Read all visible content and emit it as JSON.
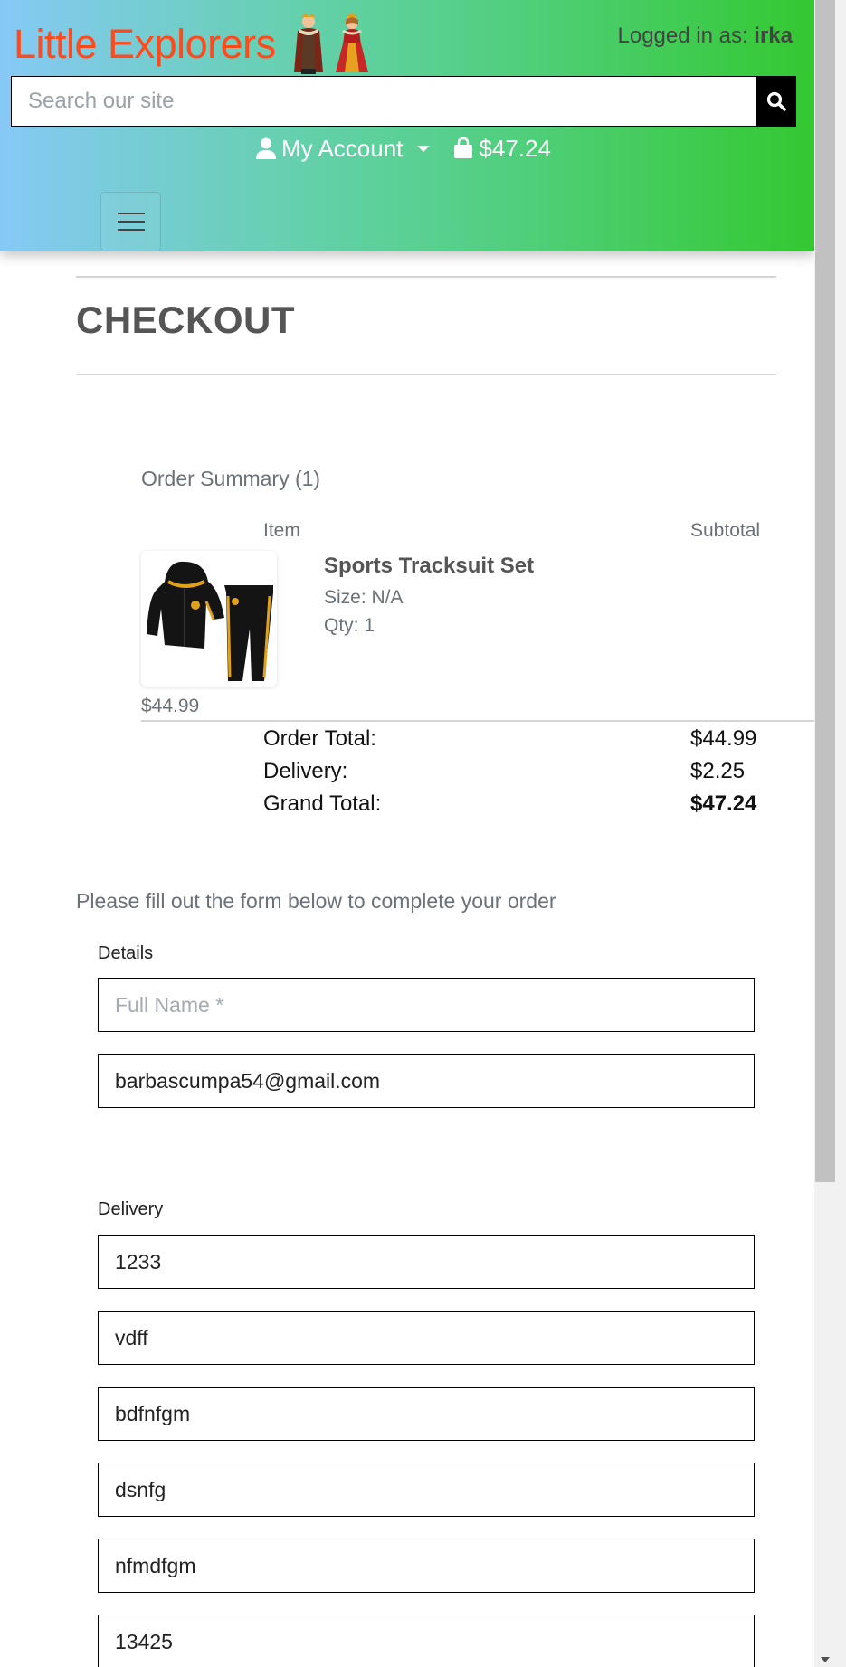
{
  "header": {
    "brand": "Little Explorers",
    "logged_in_prefix": "Logged in as:",
    "username": "irka",
    "search_placeholder": "Search our site",
    "account_label": "My Account",
    "bag_total": "$47.24"
  },
  "checkout": {
    "title": "CHECKOUT",
    "summary_heading": "Order Summary (1)",
    "col_item": "Item",
    "col_subtotal": "Subtotal",
    "product": {
      "name": "Sports Tracksuit Set",
      "size": "Size: N/A",
      "qty": "Qty: 1",
      "price": "$44.99"
    },
    "totals": [
      {
        "label": "Order Total:",
        "value": "$44.99"
      },
      {
        "label": "Delivery:",
        "value": "$2.25"
      },
      {
        "label": "Grand Total:",
        "value": "$47.24"
      }
    ],
    "instructions": "Please fill out the form below to complete your order"
  },
  "form": {
    "details_label": "Details",
    "full_name_placeholder": "Full Name *",
    "email_value": "barbascumpa54@gmail.com",
    "delivery_label": "Delivery",
    "delivery_fields": [
      "1233",
      "vdff",
      "bdfnfgm",
      "dsnfg",
      "nfmdfgm",
      "13425"
    ]
  },
  "colors": {
    "brand": "#ff4a1c",
    "header_gradient_start": "#86c9f6",
    "header_gradient_end": "#34c830"
  }
}
